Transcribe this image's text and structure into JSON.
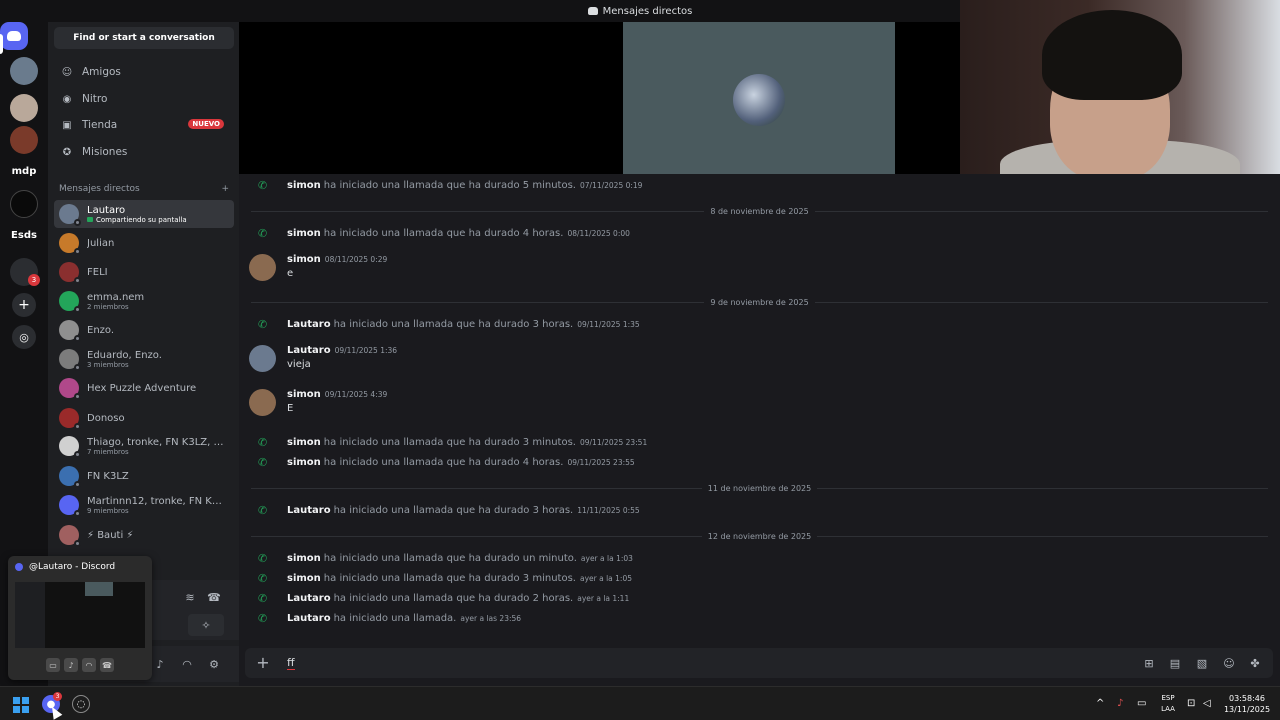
{
  "window": {
    "title": "Mensajes directos"
  },
  "colors": {
    "accent": "#5865f2",
    "green": "#23a55a",
    "red": "#da373c"
  },
  "rail": {
    "label_mdp": "mdp",
    "label_esds": "Esds",
    "folder_badge": "3"
  },
  "sidebar": {
    "search_button": "Find or start a conversation",
    "nav": [
      {
        "label": "Amigos",
        "icon": "friends-icon"
      },
      {
        "label": "Nitro",
        "icon": "nitro-icon"
      },
      {
        "label": "Tienda",
        "icon": "shop-icon",
        "badge": "NUEVO"
      },
      {
        "label": "Misiones",
        "icon": "quests-icon"
      }
    ],
    "dm_header": "Mensajes directos",
    "dm_add": "+",
    "dms": [
      {
        "name": "Lautaro",
        "sub": "Compartiendo su pantalla",
        "color": "#6b7a8f"
      },
      {
        "name": "Julian",
        "sub": "",
        "color": "#c77a2a"
      },
      {
        "name": "FELI",
        "sub": "",
        "color": "#8a2f2f"
      },
      {
        "name": "emma.nem",
        "sub": "2 miembros",
        "color": "#23a55a"
      },
      {
        "name": "Enzo.",
        "sub": "",
        "color": "#8f8f8f"
      },
      {
        "name": "Eduardo, Enzo.",
        "sub": "3 miembros",
        "color": "#7c7c7c"
      },
      {
        "name": "Hex Puzzle Adventure",
        "sub": "",
        "color": "#b0488a"
      },
      {
        "name": "Donoso",
        "sub": "",
        "color": "#9a2a2a"
      },
      {
        "name": "Thiago, tronke, FN K3LZ, E...",
        "sub": "7 miembros",
        "color": "#d0d0d0"
      },
      {
        "name": "FN K3LZ",
        "sub": "",
        "color": "#3b6fb0"
      },
      {
        "name": "Martinnn12, tronke, FN K3L...",
        "sub": "9 miembros",
        "color": "#5865f2"
      },
      {
        "name": "⚡ Bauti ⚡",
        "sub": "",
        "color": "#a06060"
      }
    ]
  },
  "preview": {
    "title": "@Lautaro - Discord"
  },
  "chat": {
    "rows": [
      {
        "kind": "call",
        "who": "simon",
        "text": "ha iniciado una llamada que ha durado 5 minutos.",
        "ts": "07/11/2025 0:19"
      },
      {
        "kind": "divider",
        "label": "8 de noviembre de 2025"
      },
      {
        "kind": "call",
        "who": "simon",
        "text": "ha iniciado una llamada que ha durado 4 horas.",
        "ts": "08/11/2025 0:00"
      },
      {
        "kind": "msg",
        "who": "simon",
        "ts": "08/11/2025 0:29",
        "body": "e"
      },
      {
        "kind": "divider",
        "label": "9 de noviembre de 2025"
      },
      {
        "kind": "call",
        "who": "Lautaro",
        "text": "ha iniciado una llamada que ha durado 3 horas.",
        "ts": "09/11/2025 1:35"
      },
      {
        "kind": "msg",
        "who": "Lautaro",
        "ts": "09/11/2025 1:36",
        "body": "vieja"
      },
      {
        "kind": "msg",
        "who": "simon",
        "ts": "09/11/2025 4:39",
        "body": "E"
      },
      {
        "kind": "call",
        "who": "simon",
        "text": "ha iniciado una llamada que ha durado 3 minutos.",
        "ts": "09/11/2025 23:51"
      },
      {
        "kind": "call",
        "who": "simon",
        "text": "ha iniciado una llamada que ha durado 4 horas.",
        "ts": "09/11/2025 23:55"
      },
      {
        "kind": "divider",
        "label": "11 de noviembre de 2025"
      },
      {
        "kind": "call",
        "who": "Lautaro",
        "text": "ha iniciado una llamada que ha durado 3 horas.",
        "ts": "11/11/2025 0:55"
      },
      {
        "kind": "divider",
        "label": "12 de noviembre de 2025"
      },
      {
        "kind": "call",
        "who": "simon",
        "text": "ha iniciado una llamada que ha durado un minuto.",
        "ts": "ayer a la 1:03"
      },
      {
        "kind": "call",
        "who": "simon",
        "text": "ha iniciado una llamada que ha durado 3 minutos.",
        "ts": "ayer a la 1:05"
      },
      {
        "kind": "call",
        "who": "Lautaro",
        "text": "ha iniciado una llamada que ha durado 2 horas.",
        "ts": "ayer a la 1:11"
      },
      {
        "kind": "call",
        "who": "Lautaro",
        "text": "ha iniciado una llamada.",
        "ts": "ayer a las 23:56"
      }
    ]
  },
  "composer": {
    "value": "ff"
  },
  "taskbar": {
    "lang_1": "ESP",
    "lang_2": "LAA",
    "time": "03:58:46",
    "date": "13/11/2025",
    "discord_badge": "3"
  }
}
